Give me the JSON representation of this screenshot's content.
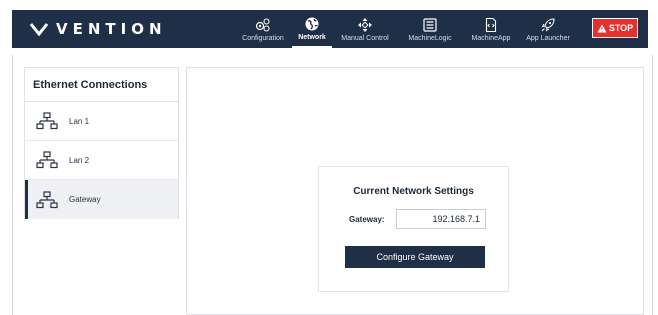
{
  "brand": {
    "name": "VENTION"
  },
  "nav": {
    "items": [
      {
        "label": "Configuration",
        "icon": "gears-icon",
        "active": false
      },
      {
        "label": "Network",
        "icon": "globe-icon",
        "active": true
      },
      {
        "label": "Manual Control",
        "icon": "directional-pad-icon",
        "active": false
      },
      {
        "label": "MachineLogic",
        "icon": "machinelogic-icon",
        "active": false
      },
      {
        "label": "MachineApp",
        "icon": "code-file-icon",
        "active": false
      },
      {
        "label": "App Launcher",
        "icon": "rocket-icon",
        "active": false
      }
    ],
    "stop_label": "STOP"
  },
  "sidebar": {
    "title": "Ethernet Connections",
    "items": [
      {
        "label": "Lan 1",
        "icon": "network-icon",
        "active": false
      },
      {
        "label": "Lan 2",
        "icon": "network-icon",
        "active": false
      },
      {
        "label": "Gateway",
        "icon": "network-icon",
        "active": true
      }
    ]
  },
  "settings": {
    "title": "Current Network Settings",
    "gateway_label": "Gateway:",
    "gateway_value": "192.168.7.1",
    "configure_label": "Configure Gateway"
  },
  "colors": {
    "header_bg": "#1f2f47",
    "stop_red": "#e3312d",
    "button_bg": "#1f2f47",
    "active_item_bg": "#eef0f4"
  }
}
